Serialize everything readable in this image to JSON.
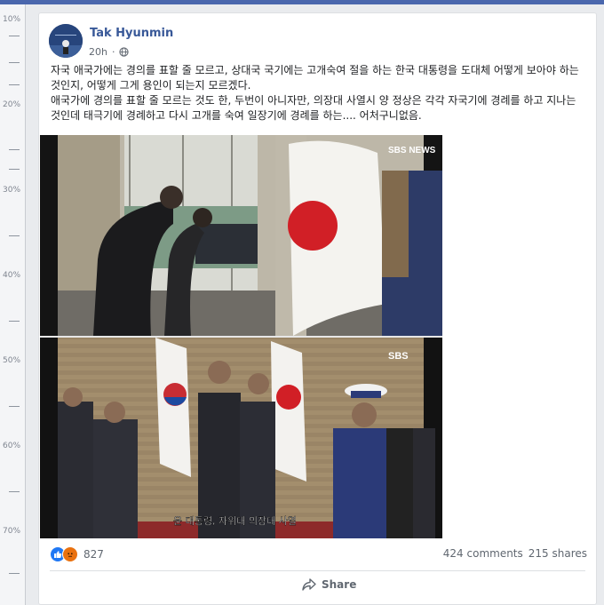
{
  "ruler": {
    "labels": [
      "10%",
      "20%",
      "30%",
      "40%",
      "50%",
      "60%",
      "70%"
    ]
  },
  "post": {
    "author": "Tak Hyunmin",
    "time": "20h",
    "privacy_icon": "globe-icon",
    "text": "자국 애국가에는 경의를 표할 줄 모르고, 상대국 국기에는 고개숙여 절을 하는 한국 대통령을 도대체 어떻게 보아야 하는 것인지, 어떻게 그게 용인이 되는지 모르겠다.\n애국가에 경의를 표할 줄 모르는 것도 한, 두번이 아니자만, 의장대 사열시 양 정상은 각각 자국기에 경례를 하고 지나는 것인데 태극기에 경례하고 다시 고개를 숙여 일장기에 경례를 하는.... 어처구니없음."
  },
  "media": {
    "watermark_top": "SBS NEWS",
    "watermark_bottom": "SBS",
    "caption": "윤 대통령, 자위대 의장대 사열"
  },
  "footer": {
    "reaction_icons": [
      "like-icon",
      "angry-icon"
    ],
    "reaction_count": "827",
    "comments": "424 comments",
    "shares": "215 shares",
    "share_label": "Share"
  },
  "colors": {
    "link": "#385898",
    "topbar": "#4a67ad",
    "like": "#2078f4",
    "angry": "#e9710f"
  }
}
